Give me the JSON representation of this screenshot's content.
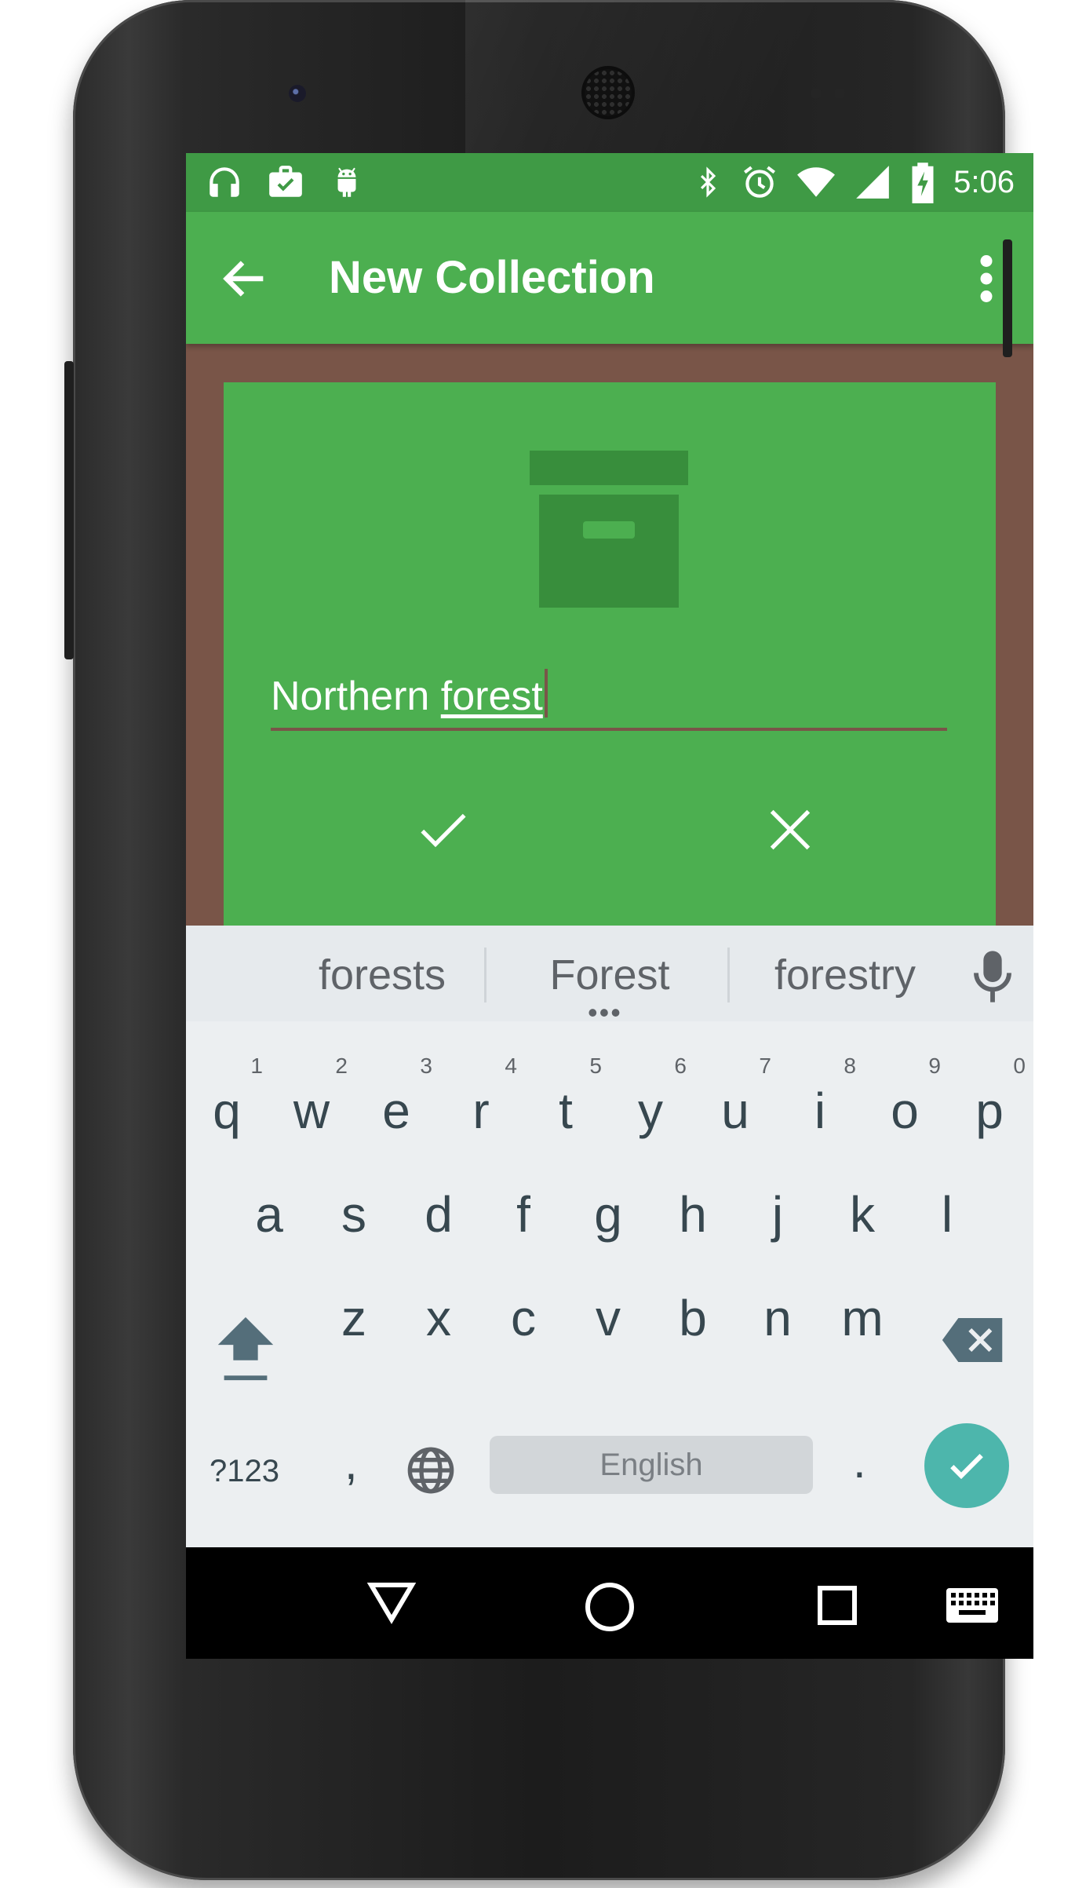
{
  "status_bar": {
    "time": "5:06",
    "left_icons": [
      "headphones-icon",
      "work-briefcase-icon",
      "android-debug-icon"
    ],
    "right_icons": [
      "bluetooth-icon",
      "alarm-icon",
      "wifi-icon",
      "cell-signal-icon",
      "battery-charging-icon"
    ]
  },
  "app_bar": {
    "title": "New Collection",
    "background_color": "#4caf50",
    "status_color": "#3f9a45"
  },
  "dialog": {
    "icon": "archive-box-icon",
    "input": {
      "value_plain": "Northern ",
      "value_composing": "forest"
    },
    "actions": [
      "confirm-check-icon",
      "cancel-close-icon"
    ],
    "background_color": "#4caf50",
    "frame_color": "#795548"
  },
  "keyboard": {
    "suggestions": [
      "forests",
      "Forest",
      "forestry"
    ],
    "row1": [
      {
        "key": "q",
        "hint": "1"
      },
      {
        "key": "w",
        "hint": "2"
      },
      {
        "key": "e",
        "hint": "3"
      },
      {
        "key": "r",
        "hint": "4"
      },
      {
        "key": "t",
        "hint": "5"
      },
      {
        "key": "y",
        "hint": "6"
      },
      {
        "key": "u",
        "hint": "7"
      },
      {
        "key": "i",
        "hint": "8"
      },
      {
        "key": "o",
        "hint": "9"
      },
      {
        "key": "p",
        "hint": "0"
      }
    ],
    "row2": [
      "a",
      "s",
      "d",
      "f",
      "g",
      "h",
      "j",
      "k",
      "l"
    ],
    "row3": [
      "z",
      "x",
      "c",
      "v",
      "b",
      "n",
      "m"
    ],
    "symbols_label": "?123",
    "comma": ",",
    "space_label": "English",
    "period": ".",
    "enter_color": "#4db6ac"
  },
  "nav_bar": {
    "buttons": [
      "back-triangle-icon",
      "home-circle-icon",
      "recents-square-icon",
      "keyboard-switch-icon"
    ]
  }
}
